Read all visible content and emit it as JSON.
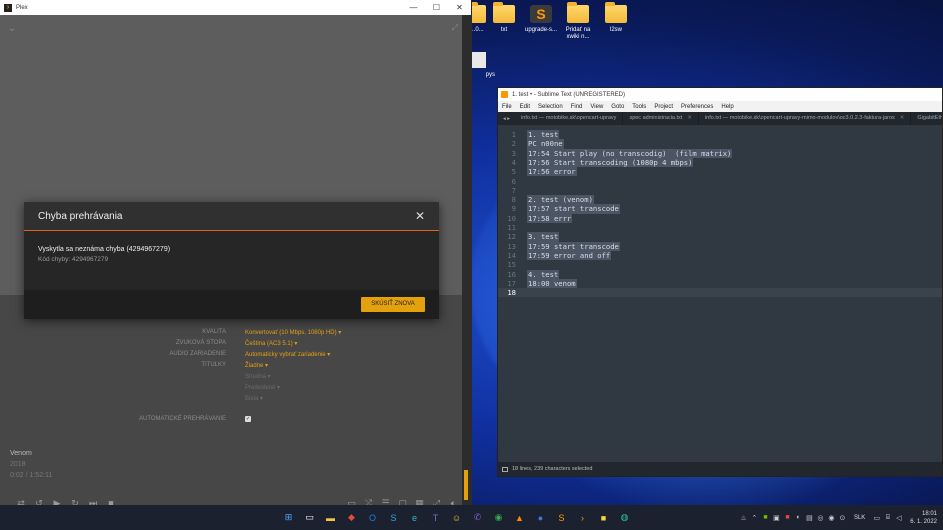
{
  "desktop": {
    "icons": [
      {
        "label": "...0...",
        "kind": "folder"
      },
      {
        "label": "txt",
        "kind": "folder"
      },
      {
        "label": "upgrade-s...",
        "kind": "sublime"
      },
      {
        "label": "Pridať na xwiki n...",
        "kind": "folder"
      },
      {
        "label": "l2sw",
        "kind": "folder"
      }
    ],
    "partial_label": "pys"
  },
  "plex": {
    "window_title": "Plex",
    "controls": {
      "minimize": "—",
      "maximize": "☐",
      "close": "✕"
    },
    "settings": [
      {
        "label": "KVALITA",
        "value": "Konvertovať (10 Mbps, 1080p HD) ▾",
        "dim": false
      },
      {
        "label": "ZVUKOVÁ STOPA",
        "value": "Čeština (AC3 5.1) ▾",
        "dim": false
      },
      {
        "label": "AUDIO ZARIADENIE",
        "value": "Automaticky vybrať zariadenie ▾",
        "dim": false
      },
      {
        "label": "TITULKY",
        "value": "Žiadne ▾",
        "dim": false
      },
      {
        "label": "",
        "value": "Stredná ▾",
        "dim": true
      },
      {
        "label": "",
        "value": "Predvolené ▾",
        "dim": true
      },
      {
        "label": "",
        "value": "Biela ▾",
        "dim": true
      },
      {
        "label": "",
        "value": "",
        "dim": true
      },
      {
        "label": "AUTOMATICKÉ PREHRÁVANIE",
        "value": "",
        "dim": false,
        "checkbox": true
      }
    ],
    "now_playing": {
      "title": "Venom",
      "year": "2018",
      "time": "0:02 / 1:52:11"
    },
    "dialog": {
      "title": "Chyba prehrávania",
      "message": "Vyskytla sa neznáma chyba (4294967279)",
      "code": "Kód chyby: 4294967279",
      "button": "SKÚSIŤ ZNOVA"
    }
  },
  "sublime": {
    "window_title": "1. test • - Sublime Text (UNREGISTERED)",
    "menu": [
      "File",
      "Edit",
      "Selection",
      "Find",
      "View",
      "Goto",
      "Tools",
      "Project",
      "Preferences",
      "Help"
    ],
    "tabs": [
      "info.txt — motobike.sk\\opencart-upravy",
      "spec administracia.txt",
      "info.txt — motobike.sk\\opencart-upravy-mimo-modulov\\oc3.0.2.3-faktura-jaros",
      "GigabitEthernet4/5.82"
    ],
    "lines": [
      "1. test",
      "PC n00ne",
      "17:54 Start play (no transcodig)  (film matrix)",
      "17:56 Start transcoding (1080p 4 mbps)",
      "17:56 error",
      "",
      "",
      "2. test (venom)",
      "17:57 start transcode",
      "17:58 errr",
      "",
      "3. test",
      "17:59 start transcode",
      "17:59 error and off",
      "",
      "4. test",
      "18:00 venom",
      ""
    ],
    "status": "18 lines, 239 characters selected"
  },
  "taskbar": {
    "icons": [
      {
        "name": "start-icon",
        "glyph": "⊞",
        "color": "#4aa3ff"
      },
      {
        "name": "task-view-icon",
        "glyph": "▭",
        "color": "#ffffff"
      },
      {
        "name": "explorer-icon",
        "glyph": "▬",
        "color": "#f4c542"
      },
      {
        "name": "anydesk-icon",
        "glyph": "◆",
        "color": "#e34b3f"
      },
      {
        "name": "outlook-icon",
        "glyph": "O",
        "color": "#1d7bd8"
      },
      {
        "name": "skype-icon",
        "glyph": "S",
        "color": "#2ea6e0"
      },
      {
        "name": "edge-icon",
        "glyph": "e",
        "color": "#2fb8c4"
      },
      {
        "name": "teams-icon",
        "glyph": "T",
        "color": "#6b6fd4"
      },
      {
        "name": "smiley-icon",
        "glyph": "☺",
        "color": "#f0c030"
      },
      {
        "name": "viber-icon",
        "glyph": "✆",
        "color": "#7c5cd6"
      },
      {
        "name": "chrome-icon",
        "glyph": "◉",
        "color": "#34a853"
      },
      {
        "name": "vlc-icon",
        "glyph": "▲",
        "color": "#ff8800"
      },
      {
        "name": "app-icon",
        "glyph": "●",
        "color": "#3a7ad9"
      },
      {
        "name": "sublime-icon",
        "glyph": "S",
        "color": "#ff9800"
      },
      {
        "name": "plex-icon",
        "glyph": "›",
        "color": "#e5a00d"
      },
      {
        "name": "sticky-notes-icon",
        "glyph": "■",
        "color": "#f6d53d"
      },
      {
        "name": "browser-icon",
        "glyph": "◍",
        "color": "#2cc0a0"
      }
    ],
    "lang": "SLK",
    "time": "18:01",
    "date": "6. 1. 2022"
  }
}
